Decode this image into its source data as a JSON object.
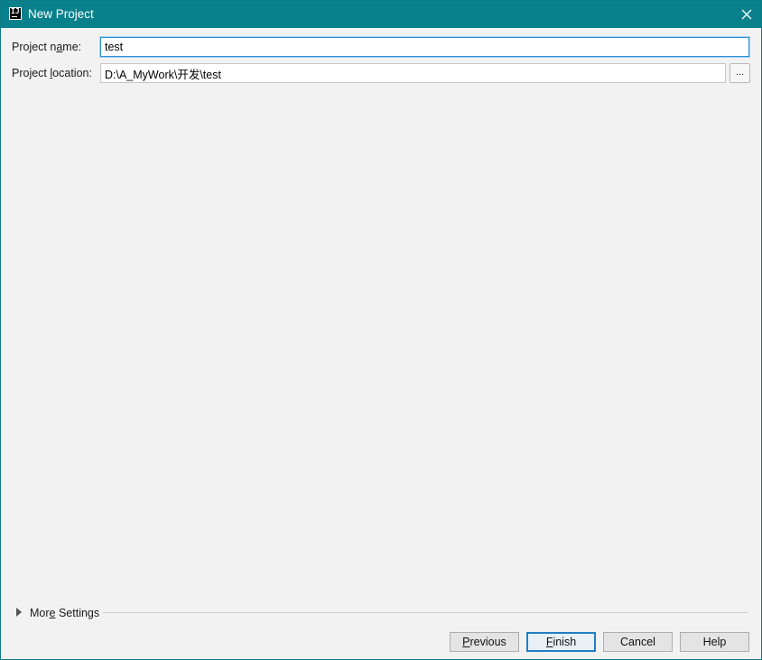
{
  "window": {
    "title": "New Project",
    "app_icon_text": "IJ",
    "accent_color": "#08818c"
  },
  "form": {
    "project_name": {
      "label_before": "Project n",
      "label_mnemonic": "a",
      "label_after": "me:",
      "value": "test"
    },
    "project_location": {
      "label_before": "Project ",
      "label_mnemonic": "l",
      "label_after": "ocation:",
      "value": "D:\\A_MyWork\\开发\\test",
      "browse_label": "..."
    }
  },
  "more_settings": {
    "label_before": "Mor",
    "label_mnemonic": "e",
    "label_after": " Settings",
    "expanded": false
  },
  "buttons": {
    "previous": {
      "mnemonic": "P",
      "rest": "revious"
    },
    "finish": {
      "mnemonic": "F",
      "rest": "inish"
    },
    "cancel": {
      "label": "Cancel"
    },
    "help": {
      "label": "Help"
    }
  },
  "icons": {
    "app": "intellij-idea-icon",
    "close": "close-icon",
    "expand": "triangle-right-icon"
  }
}
